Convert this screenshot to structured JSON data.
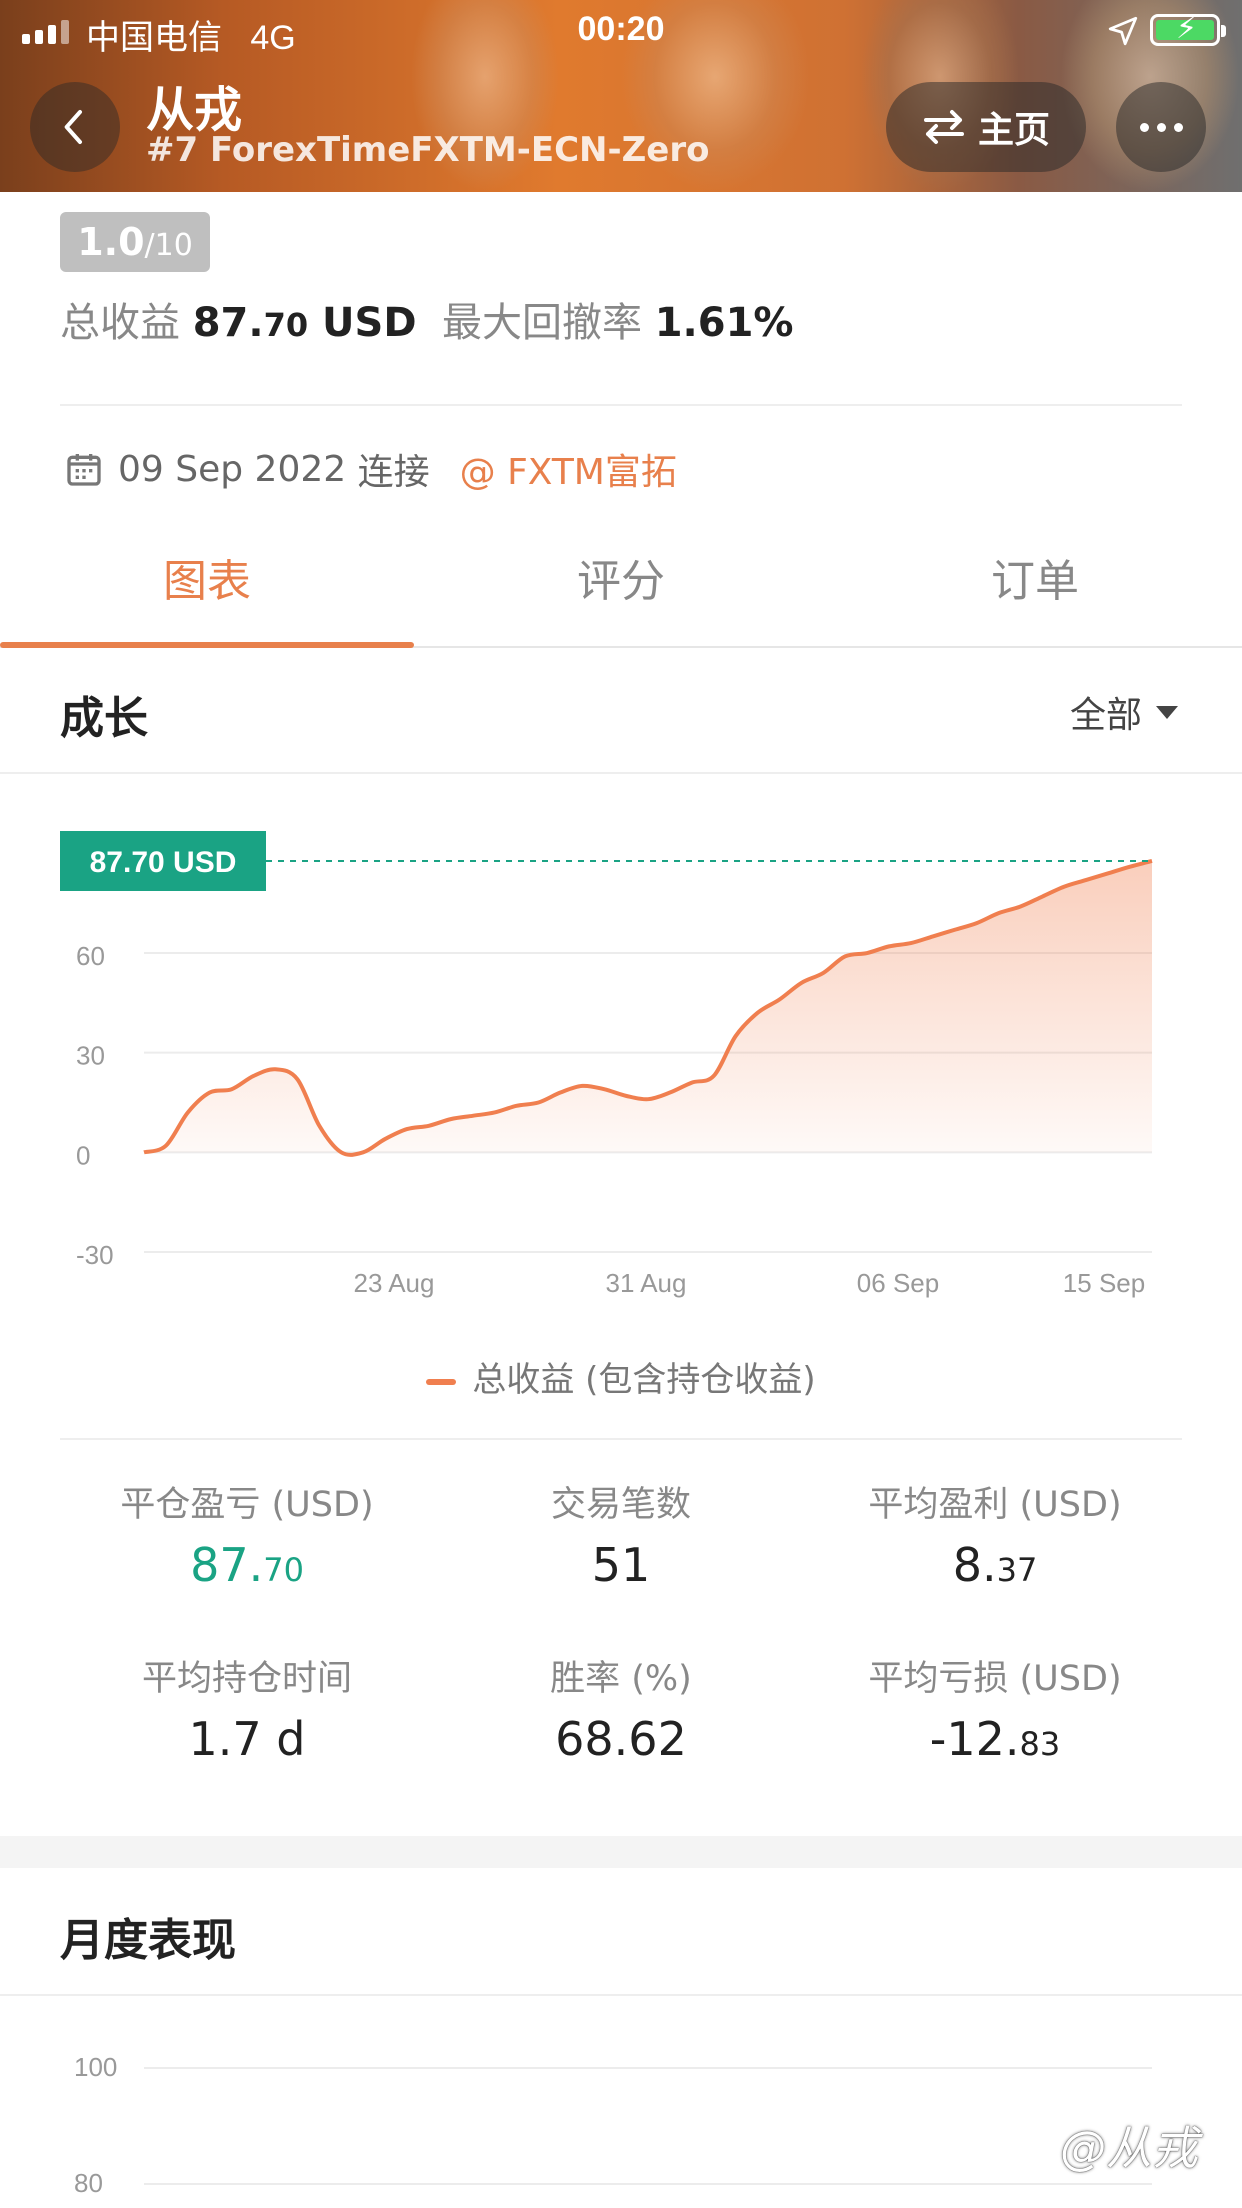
{
  "status_bar": {
    "carrier": "中国电信",
    "network": "4G",
    "time": "00:20"
  },
  "header": {
    "title": "从戎",
    "subtitle": "#7 ForexTimeFXTM-ECN-Zero",
    "home_label": "主页",
    "back_icon": "chevron-left-icon",
    "swap_icon": "swap-arrows-icon",
    "more_icon": "more-dots-icon"
  },
  "profile": {
    "score": "1.0",
    "score_max": "/10",
    "total_profit_label": "总收益",
    "total_profit_int": "87.",
    "total_profit_dec": "70",
    "total_profit_unit": "USD",
    "max_drawdown_label": "最大回撤率",
    "max_drawdown_value": "1.61%",
    "connect_date": "09 Sep 2022",
    "connect_label": "连接",
    "broker": "@ FXTM富拓"
  },
  "tabs": [
    {
      "label": "图表",
      "active": true
    },
    {
      "label": "评分",
      "active": false
    },
    {
      "label": "订单",
      "active": false
    }
  ],
  "growth": {
    "title": "成长",
    "filter_label": "全部"
  },
  "chart_data": {
    "type": "area",
    "latest_label": "87.70 USD",
    "y_ticks": [
      60,
      30,
      0,
      -30
    ],
    "ylim": [
      -30,
      88
    ],
    "x_tick_labels": [
      "23 Aug",
      "31 Aug",
      "06 Sep",
      "15 Sep"
    ],
    "series": [
      {
        "name": "总收益 (包含持仓收益)",
        "color": "#f07f4f",
        "values": [
          0,
          2,
          12,
          18,
          19,
          23,
          25,
          22,
          8,
          0,
          0,
          4,
          7,
          8,
          10,
          11,
          12,
          14,
          15,
          18,
          20,
          19,
          17,
          16,
          18,
          21,
          23,
          35,
          42,
          46,
          51,
          54,
          59,
          60,
          62,
          63,
          65,
          67,
          69,
          72,
          74,
          77,
          80,
          82,
          84,
          86,
          87.7
        ]
      }
    ],
    "grid": true,
    "legend_position": "bottom"
  },
  "stats": [
    {
      "label": "平仓盈亏 (USD)",
      "int": "87.",
      "dec": "70",
      "highlight": true
    },
    {
      "label": "交易笔数",
      "int": "51",
      "dec": "",
      "highlight": false
    },
    {
      "label": "平均盈利 (USD)",
      "int": "8.",
      "dec": "37",
      "highlight": false
    },
    {
      "label": "平均持仓时间",
      "int": "1.7 d",
      "dec": "",
      "highlight": false
    },
    {
      "label": "胜率 (%)",
      "int": "68.62",
      "dec": "",
      "highlight": false
    },
    {
      "label": "平均亏损 (USD)",
      "int": "-12.",
      "dec": "83",
      "highlight": false
    }
  ],
  "monthly": {
    "title": "月度表现",
    "y_ticks": [
      100,
      80
    ]
  },
  "watermark": "@从戎"
}
